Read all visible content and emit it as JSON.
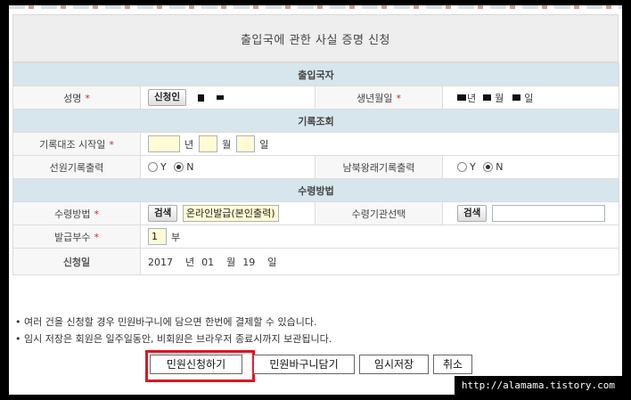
{
  "title": "출입국에 관한 사실 증명 신청",
  "sections": {
    "person": "출입국자",
    "records": "기록조회",
    "receipt": "수령방법"
  },
  "labels": {
    "name": "성명",
    "birth": "생년월일",
    "start_date": "기록대조 시작일",
    "crew_record": "선원기록출력",
    "nk_record": "남북왕래기록출력",
    "receipt_method": "수령방법",
    "agency": "수령기관선택",
    "copies": "발급부수",
    "apply_date": "신청일"
  },
  "required_mark": "*",
  "applicant_button": "신청인",
  "birth_units": {
    "year": "년",
    "month": "월",
    "day": "일"
  },
  "date_units": {
    "year": "년",
    "month": "월",
    "day": "일"
  },
  "radio": {
    "y": "Y",
    "n": "N",
    "crew_selected": "N",
    "nk_selected": "N"
  },
  "search_button": "검색",
  "receipt_value": "온라인발급(본인출력)",
  "agency_value": "",
  "copies_value": "1",
  "copies_unit": "부",
  "apply_date": {
    "year": "2017",
    "year_unit": "년",
    "month": "01",
    "month_unit": "월",
    "day": "19",
    "day_unit": "일"
  },
  "notes": [
    "여러 건을 신청할 경우 민원바구니에 담으면 한번에 결제할 수 있습니다.",
    "임시 저장은 회원은 일주일동안, 비회원은 브라우저 종료시까지 보관됩니다."
  ],
  "buttons": {
    "apply": "민원신청하기",
    "basket": "민원바구니담기",
    "save_temp": "임시저장",
    "cancel": "취소"
  },
  "watermark": "http://alamama.tistory.com",
  "colors": {
    "section_bg": "#d6e6ec",
    "required": "#cc2a2a",
    "highlight": "#e0141e",
    "input_yellow": "#fffbd4"
  }
}
